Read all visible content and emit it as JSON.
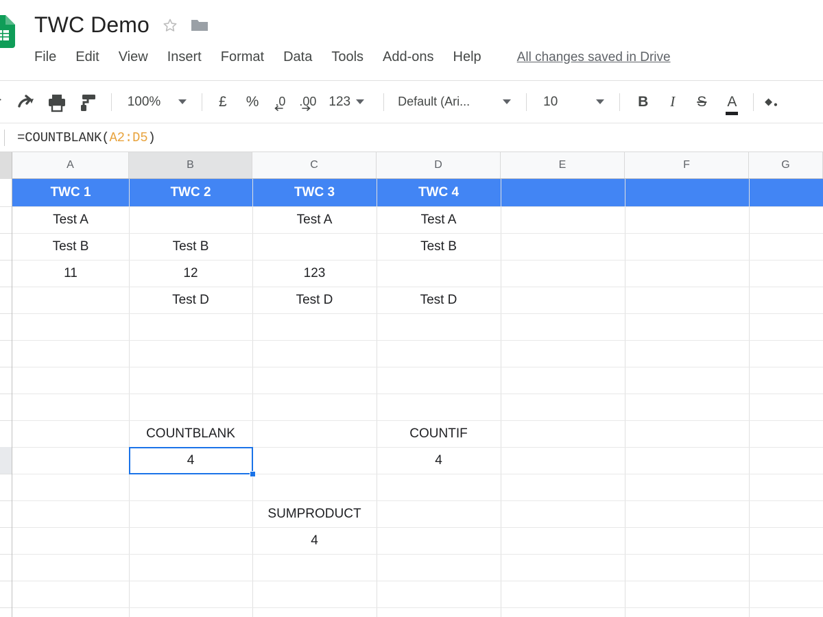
{
  "app": {
    "logo_icon": "google-sheets-logo",
    "title": "TWC Demo",
    "star_icon": "star-outline-icon",
    "folder_icon": "folder-icon",
    "save_status": "All changes saved in Drive"
  },
  "menubar": {
    "items": [
      {
        "label": "File"
      },
      {
        "label": "Edit"
      },
      {
        "label": "View"
      },
      {
        "label": "Insert"
      },
      {
        "label": "Format"
      },
      {
        "label": "Data"
      },
      {
        "label": "Tools"
      },
      {
        "label": "Add-ons"
      },
      {
        "label": "Help"
      }
    ]
  },
  "toolbar": {
    "undo_icon": "undo-icon",
    "redo_icon": "redo-icon",
    "print_icon": "print-icon",
    "paint_format_icon": "paint-format-icon",
    "zoom_value": "100%",
    "currency_label": "£",
    "percent_label": "%",
    "decrease_decimal_label": ".0",
    "increase_decimal_label": ".00",
    "number_format_label": "123",
    "font_value": "Default (Ari...",
    "font_size_value": "10",
    "bold_label": "B",
    "italic_label": "I",
    "strikethrough_label": "S",
    "text_color_label": "A",
    "fill_color_icon": "fill-color-icon"
  },
  "formula_bar": {
    "fx_icon": "fx-icon",
    "formula_prefix": "=COUNTBLANK(",
    "formula_ref": "A2:D5",
    "formula_suffix": ")"
  },
  "sheet": {
    "columns": [
      "A",
      "B",
      "C",
      "D",
      "E",
      "F",
      "G"
    ],
    "active_column": "B",
    "header_row": {
      "values": [
        "TWC 1",
        "TWC 2",
        "TWC 3",
        "TWC 4"
      ],
      "background": "#4285f4",
      "text_color": "#ffffff"
    },
    "data_rows": [
      [
        "Test A",
        "",
        "Test A",
        "Test A"
      ],
      [
        "Test B",
        "Test B",
        "",
        "Test B"
      ],
      [
        "11",
        "12",
        "123",
        ""
      ],
      [
        "",
        "Test D",
        "Test D",
        "Test D"
      ]
    ],
    "labels": {
      "countblank_label": "COUNTBLANK",
      "countblank_value": "4",
      "countif_label": "COUNTIF",
      "countif_value": "4",
      "sumproduct_label": "SUMPRODUCT",
      "sumproduct_value": "4"
    },
    "selection": {
      "border_color": "#1a73e8",
      "column": "B"
    }
  }
}
